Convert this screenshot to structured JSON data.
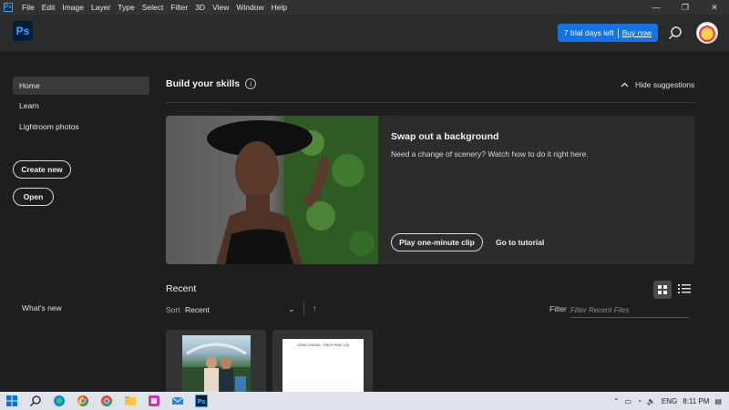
{
  "menubar": {
    "app_icon": "photoshop-icon",
    "items": [
      "File",
      "Edit",
      "Image",
      "Layer",
      "Type",
      "Select",
      "Filter",
      "3D",
      "View",
      "Window",
      "Help"
    ],
    "window_controls": [
      "—",
      "❐",
      "✕"
    ]
  },
  "header": {
    "logo_text": "Ps",
    "trial_text": "7 trial days left",
    "buy_text": "Buy now"
  },
  "sidebar": {
    "items": [
      {
        "label": "Home",
        "active": true
      },
      {
        "label": "Learn",
        "active": false
      },
      {
        "label": "Lightroom photos",
        "active": false
      }
    ],
    "create_new": "Create new",
    "open": "Open",
    "whats_new": "What's new"
  },
  "skills": {
    "title": "Build your skills",
    "hide_label": "Hide suggestions",
    "card": {
      "title": "Swap out a background",
      "description": "Need a change of scenery? Watch how to do it right here.",
      "play_label": "Play one-minute clip",
      "tutorial_label": "Go to tutorial"
    }
  },
  "recent": {
    "title": "Recent",
    "sort_label": "Sort",
    "sort_value": "Recent",
    "sort_dir": "↑",
    "filter_label": "Filter",
    "filter_placeholder": "Filter Recent Files",
    "files": [
      {
        "kind": "photo"
      },
      {
        "kind": "document",
        "text": "CÔNG CHỨNG - THỊCH PHÁT LỘI"
      }
    ]
  },
  "taskbar": {
    "language": "ENG",
    "time": "8:11 PM"
  },
  "colors": {
    "accent": "#1473e6",
    "background": "#1e1e1e",
    "ps_blue": "#31a8ff"
  }
}
